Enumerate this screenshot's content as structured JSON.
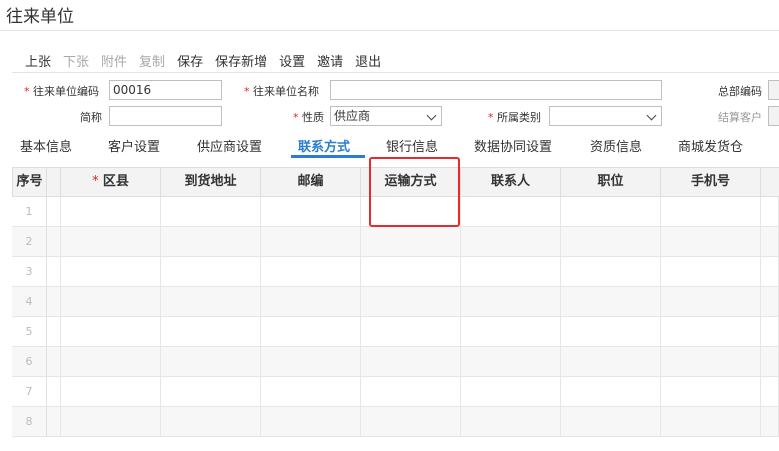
{
  "page_title": "往来单位",
  "toolbar": [
    {
      "label": "上张",
      "enabled": true
    },
    {
      "label": "下张",
      "enabled": false
    },
    {
      "label": "附件",
      "enabled": false
    },
    {
      "label": "复制",
      "enabled": false
    },
    {
      "label": "保存",
      "enabled": true
    },
    {
      "label": "保存新增",
      "enabled": true
    },
    {
      "label": "设置",
      "enabled": true
    },
    {
      "label": "邀请",
      "enabled": true
    },
    {
      "label": "退出",
      "enabled": true
    }
  ],
  "form": {
    "code_label": "往来单位编码",
    "code_value": "00016",
    "name_label": "往来单位名称",
    "name_value": "",
    "hq_code_label": "总部编码",
    "short_name_label": "简称",
    "short_name_value": "",
    "nature_label": "性质",
    "nature_value": "供应商",
    "category_label": "所属类别",
    "category_value": "",
    "settle_customer_label": "结算客户"
  },
  "tabs": [
    {
      "label": "基本信息",
      "active": false
    },
    {
      "label": "客户设置",
      "active": false
    },
    {
      "label": "供应商设置",
      "active": false
    },
    {
      "label": "联系方式",
      "active": true
    },
    {
      "label": "银行信息",
      "active": false
    },
    {
      "label": "数据协同设置",
      "active": false
    },
    {
      "label": "资质信息",
      "active": false
    },
    {
      "label": "商城发货仓",
      "active": false
    }
  ],
  "grid": {
    "seq_header": "序号",
    "columns": [
      "区县",
      "到货地址",
      "邮编",
      "运输方式",
      "联系人",
      "职位",
      "手机号"
    ],
    "required_columns": [
      "区县"
    ],
    "rows": [
      "1",
      "2",
      "3",
      "4",
      "5",
      "6",
      "7",
      "8"
    ]
  },
  "colors": {
    "accent": "#2b7dd1",
    "required": "#e1251b",
    "highlight": "#e52b2b"
  }
}
